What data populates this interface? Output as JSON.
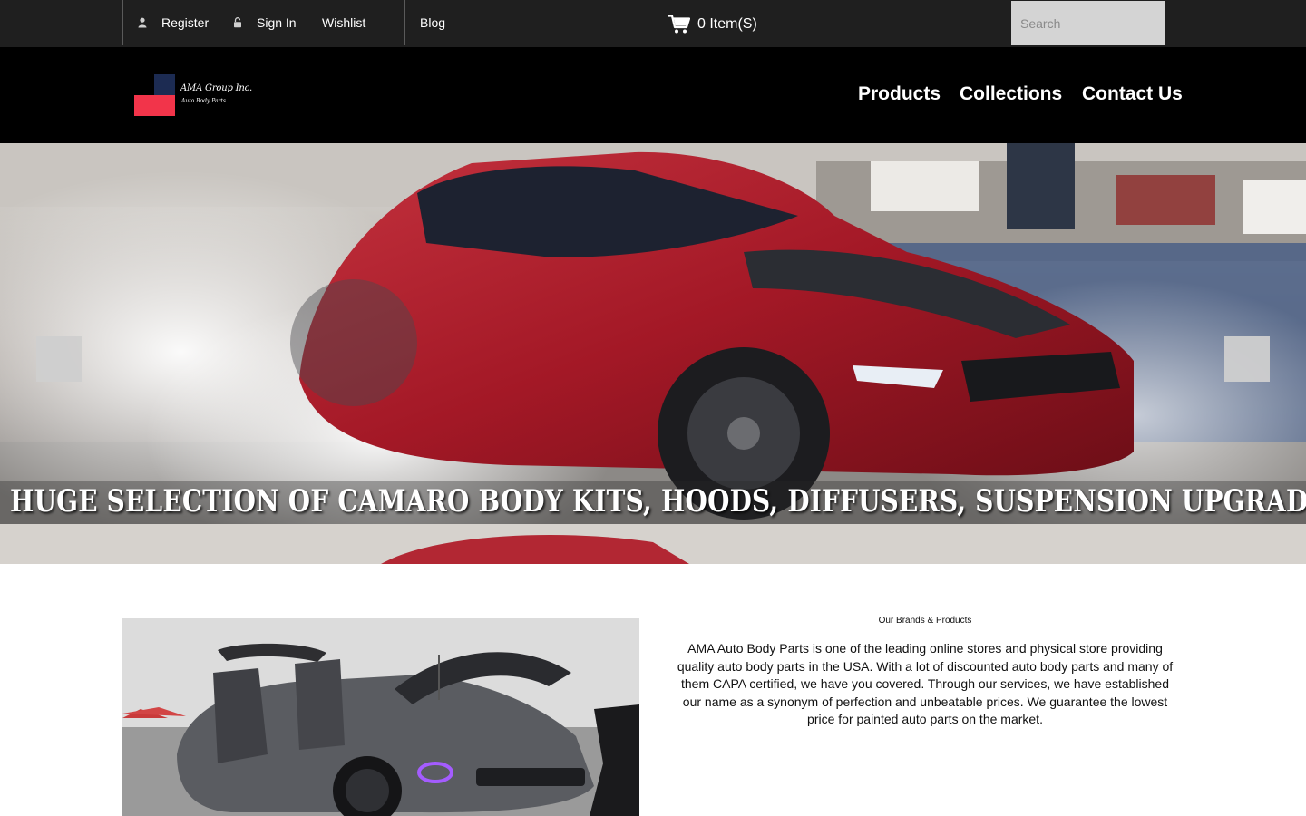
{
  "topbar": {
    "register_label": "Register",
    "register_icon": "user-icon",
    "signin_label": "Sign In",
    "signin_icon": "lock-icon",
    "wishlist_label": "Wishlist",
    "blog_label": "Blog",
    "cart_label": "0 Item(S)",
    "cart_icon": "cart-icon",
    "search_placeholder": "Search"
  },
  "header": {
    "logo_name": "AMA Group Inc.",
    "logo_tagline": "Auto Body Parts",
    "nav": [
      "Products",
      "Collections",
      "Contact Us"
    ]
  },
  "hero": {
    "caption": "HUGE SELECTION OF CAMARO BODY KITS, HOODS, DIFFUSERS, SUSPENSION UPGRADES AND MORE"
  },
  "brands": {
    "title": "Our Brands & Products",
    "text": "AMA Auto Body Parts is one of the leading online stores and physical store providing quality auto body parts in the USA. With a lot of discounted auto body parts and many of them CAPA certified, we have you covered. Through our services, we have established our name as a synonym of perfection and unbeatable prices. We guarantee the lowest price for painted auto parts on the market."
  },
  "colors": {
    "topbar_bg": "#1f1f1f",
    "header_bg": "#000000",
    "logo_red": "#f2344a",
    "logo_navy": "#1c2b52",
    "search_bg": "#d4d4d4"
  }
}
